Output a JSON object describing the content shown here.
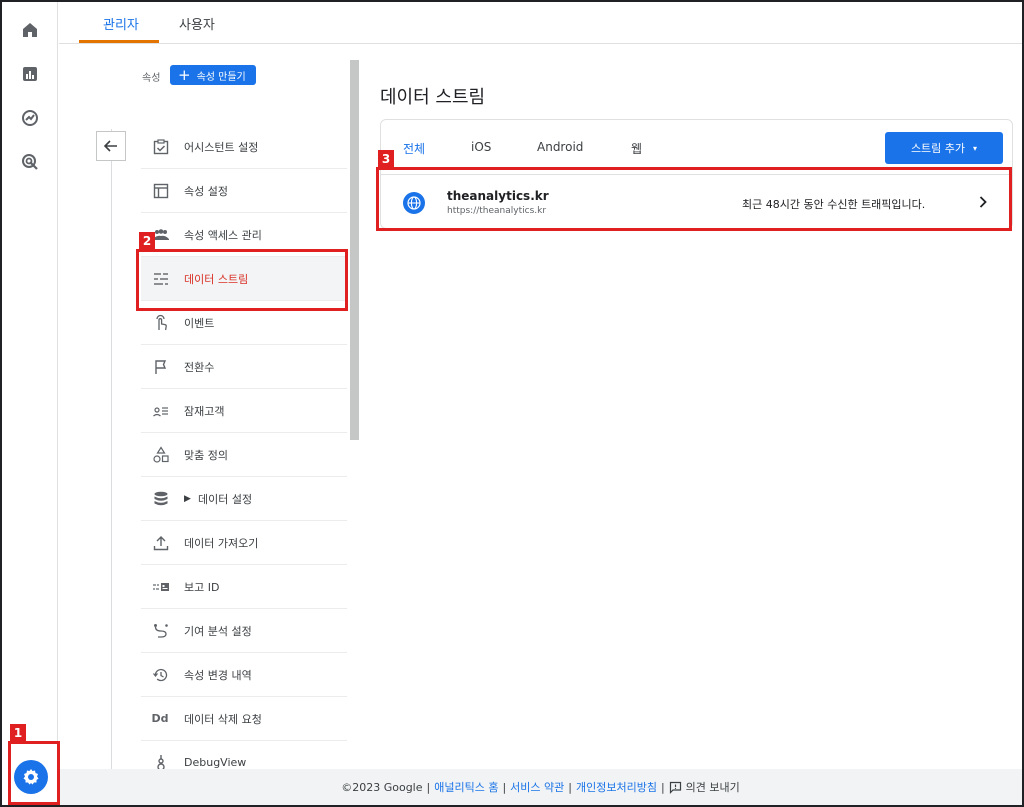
{
  "top_tabs": {
    "admin": "관리자",
    "user": "사용자"
  },
  "property": {
    "label": "속성",
    "create_button": "속성 만들기",
    "create_plus": "+"
  },
  "menu": {
    "items": [
      {
        "label": "어시스턴트 설정",
        "icon": "assistant-checkbox-icon"
      },
      {
        "label": "속성 설정",
        "icon": "layout-panel-icon"
      },
      {
        "label": "속성 액세스 관리",
        "icon": "people-group-icon"
      },
      {
        "label": "데이터 스트림",
        "icon": "streams-lines-icon",
        "selected": true
      },
      {
        "label": "이벤트",
        "icon": "touch-hand-icon"
      },
      {
        "label": "전환수",
        "icon": "flag-icon"
      },
      {
        "label": "잠재고객",
        "icon": "audience-list-icon"
      },
      {
        "label": "맞춤 정의",
        "icon": "shapes-icon"
      },
      {
        "label": "데이터 설정",
        "icon": "database-icon",
        "caret": "▶"
      },
      {
        "label": "데이터 가져오기",
        "icon": "upload-icon"
      },
      {
        "label": "보고 ID",
        "icon": "report-id-icon"
      },
      {
        "label": "기여 분석 설정",
        "icon": "attribution-path-icon"
      },
      {
        "label": "속성 변경 내역",
        "icon": "history-icon"
      },
      {
        "label": "데이터 삭제 요청",
        "icon": "dd-icon",
        "icon_text": "Dd"
      },
      {
        "label": "DebugView",
        "icon": "debug-view-icon"
      }
    ]
  },
  "content": {
    "title": "데이터 스트림",
    "tabs": [
      "전체",
      "iOS",
      "Android",
      "웹"
    ],
    "add_stream": "스트림 추가",
    "add_stream_caret": "▾",
    "stream": {
      "name": "theanalytics.kr",
      "url": "https://theanalytics.kr",
      "status": "최근 48시간 동안 수신한 트래픽입니다."
    }
  },
  "footer": {
    "copyright": "©2023 Google",
    "home": "애널리틱스 홈",
    "terms": "서비스 약관",
    "privacy": "개인정보처리방침",
    "feedback": "의견 보내기",
    "separator": "|"
  },
  "annotations": [
    "1",
    "2",
    "3"
  ],
  "colors": {
    "accent": "#1a73e8",
    "annotation": "#e02020",
    "selected_text": "#d93025",
    "tab_underline": "#e37400"
  }
}
